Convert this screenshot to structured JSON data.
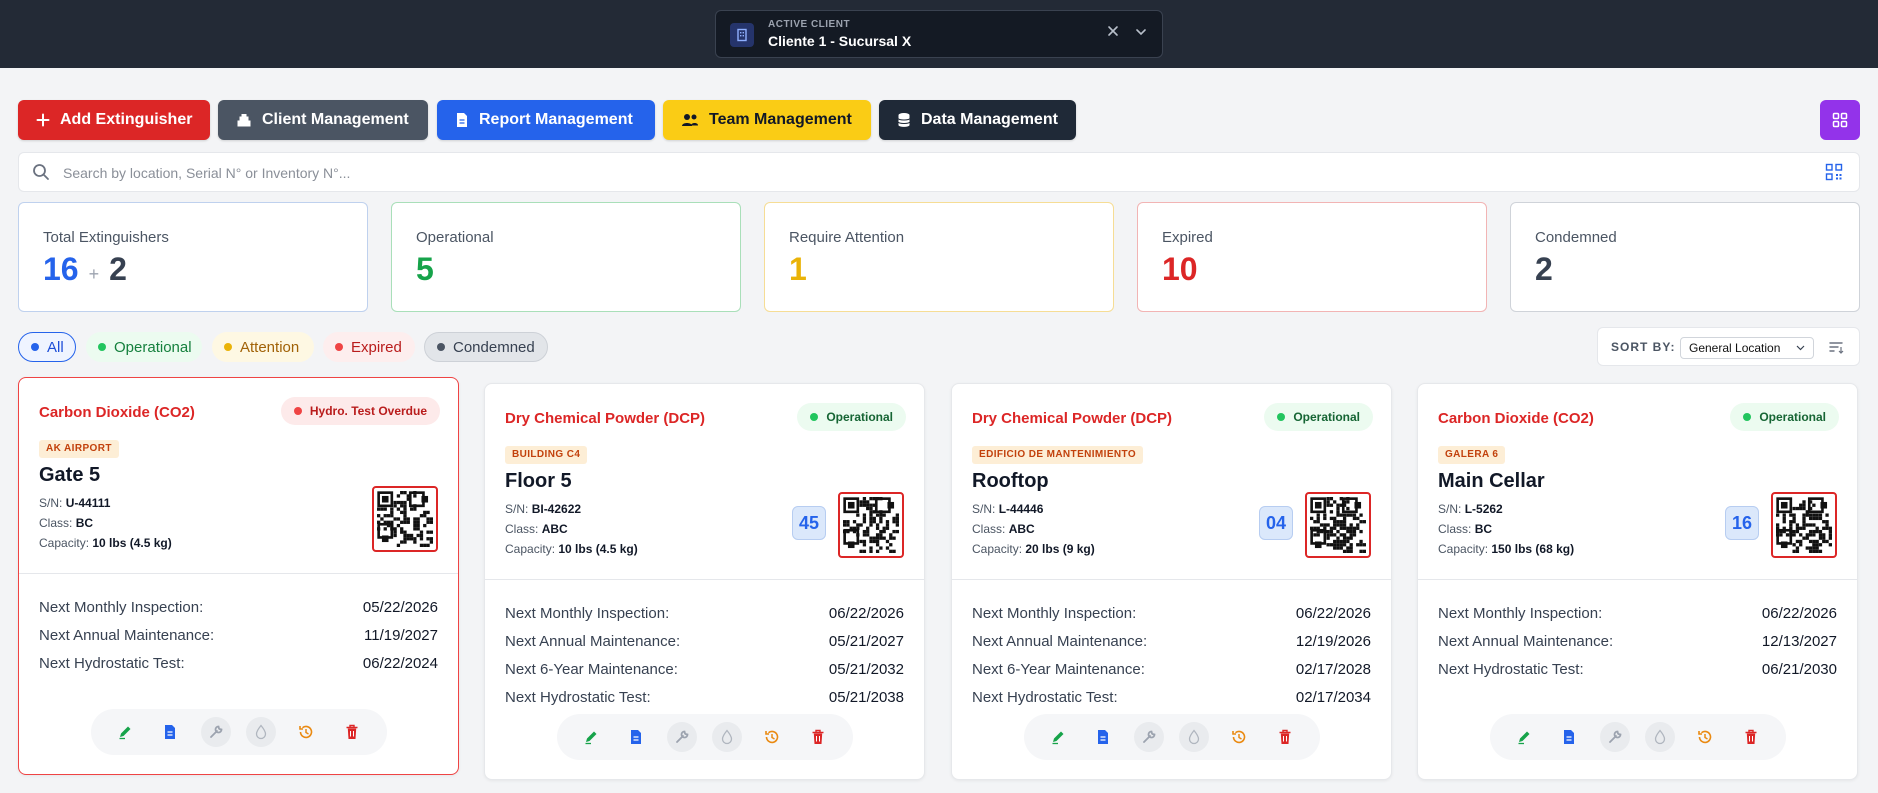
{
  "header": {
    "active_client_label": "ACTIVE CLIENT",
    "active_client_name": "Cliente 1 - Sucursal X"
  },
  "toolbar": {
    "add_label": "Add Extinguisher",
    "client_label": "Client Management",
    "report_label": "Report Management",
    "team_label": "Team Management",
    "data_label": "Data Management"
  },
  "search": {
    "placeholder": "Search by location, Serial N° or Inventory N°...",
    "value": ""
  },
  "stats": {
    "total_label": "Total Extinguishers",
    "total_value": "16",
    "total_plus": "+",
    "total_extra": "2",
    "operational_label": "Operational",
    "operational_value": "5",
    "attention_label": "Require Attention",
    "attention_value": "1",
    "expired_label": "Expired",
    "expired_value": "10",
    "condemned_label": "Condemned",
    "condemned_value": "2"
  },
  "filters": {
    "all": "All",
    "operational": "Operational",
    "attention": "Attention",
    "expired": "Expired",
    "condemned": "Condemned"
  },
  "sort": {
    "label": "SORT BY:",
    "selected": "General Location"
  },
  "colors": {
    "accent_red": "#dc2626",
    "accent_blue": "#2563eb",
    "accent_yellow": "#facc15",
    "accent_green": "#16a34a",
    "accent_purple": "#9333ea"
  },
  "cards": [
    {
      "type": "Carbon Dioxide (CO2)",
      "status": "Hydro. Test Overdue",
      "tag": "AK AIRPORT",
      "name": "Gate 5",
      "sn_label": "S/N:",
      "sn": "U-44111",
      "class_label": "Class:",
      "class": "BC",
      "capacity_label": "Capacity:",
      "capacity": "10 lbs (4.5 kg)",
      "number": "",
      "rows": [
        {
          "label": "Next Monthly Inspection:",
          "date": "05/22/2026"
        },
        {
          "label": "Next Annual Maintenance:",
          "date": "11/19/2027"
        },
        {
          "label": "Next Hydrostatic Test:",
          "date": "06/22/2024"
        }
      ]
    },
    {
      "type": "Dry Chemical Powder (DCP)",
      "status": "Operational",
      "tag": "BUILDING C4",
      "name": "Floor 5",
      "sn_label": "S/N:",
      "sn": "BI-42622",
      "class_label": "Class:",
      "class": "ABC",
      "capacity_label": "Capacity:",
      "capacity": "10 lbs (4.5 kg)",
      "number": "45",
      "rows": [
        {
          "label": "Next Monthly Inspection:",
          "date": "06/22/2026"
        },
        {
          "label": "Next Annual Maintenance:",
          "date": "05/21/2027"
        },
        {
          "label": "Next 6-Year Maintenance:",
          "date": "05/21/2032"
        },
        {
          "label": "Next Hydrostatic Test:",
          "date": "05/21/2038"
        }
      ]
    },
    {
      "type": "Dry Chemical Powder (DCP)",
      "status": "Operational",
      "tag": "EDIFICIO DE MANTENIMIENTO",
      "name": "Rooftop",
      "sn_label": "S/N:",
      "sn": "L-44446",
      "class_label": "Class:",
      "class": "ABC",
      "capacity_label": "Capacity:",
      "capacity": "20 lbs (9 kg)",
      "number": "04",
      "rows": [
        {
          "label": "Next Monthly Inspection:",
          "date": "06/22/2026"
        },
        {
          "label": "Next Annual Maintenance:",
          "date": "12/19/2026"
        },
        {
          "label": "Next 6-Year Maintenance:",
          "date": "02/17/2028"
        },
        {
          "label": "Next Hydrostatic Test:",
          "date": "02/17/2034"
        }
      ]
    },
    {
      "type": "Carbon Dioxide (CO2)",
      "status": "Operational",
      "tag": "GALERA 6",
      "name": "Main Cellar",
      "sn_label": "S/N:",
      "sn": "L-5262",
      "class_label": "Class:",
      "class": "BC",
      "capacity_label": "Capacity:",
      "capacity": "150 lbs (68 kg)",
      "number": "16",
      "rows": [
        {
          "label": "Next Monthly Inspection:",
          "date": "06/22/2026"
        },
        {
          "label": "Next Annual Maintenance:",
          "date": "12/13/2027"
        },
        {
          "label": "Next Hydrostatic Test:",
          "date": "06/21/2030"
        }
      ]
    }
  ]
}
